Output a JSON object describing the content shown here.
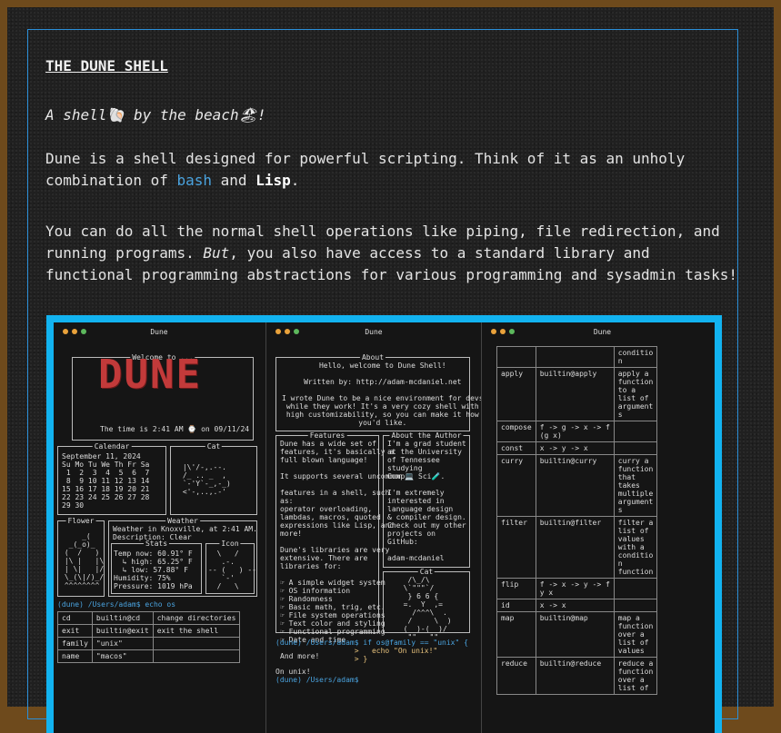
{
  "article": {
    "title": "THE DUNE SHELL",
    "tagline": "A shell🐚 by the beach🏖!",
    "p1_a": "Dune is a shell designed for powerful scripting. Think of it as an unholy",
    "p1_b": "combination of ",
    "p1_code": "bash",
    "p1_c": " and ",
    "p1_bold": "Lisp",
    "p1_d": ".",
    "p2_a": "You can do all the normal shell operations like piping, file redirection, and",
    "p2_b": "running programs. ",
    "p2_em": "But",
    "p2_c": ", you also have access to a standard library and",
    "p2_d": "functional programming abstractions for various programming and sysadmin tasks!"
  },
  "colors": {
    "accent": "#12b3f0",
    "link": "#4aa3df",
    "page_bg": "#202020",
    "frame": "#6e4a1c"
  },
  "screenshot": {
    "pane1": {
      "window_title": "Dune",
      "welcome": "Welcome to ...",
      "logo": "DUNE",
      "time_line": "The time is 2:41 AM ⌚ on 09/11/24",
      "calendar_label": "Calendar",
      "calendar_text": "September 11, 2024\nSu Mo Tu We Th Fr Sa\n 1  2  3  4  5  6  7\n 8  9 10 11 12 13 14\n15 16 17 18 19 20 21\n22 23 24 25 26 27 28\n29 30",
      "cat_label": "Cat",
      "cat_art": " |\\'/-,.--.\n /_ .. _  ,\n `-'Y`-_,-_)\n <'-,..,.-'",
      "flower_label": "Flower",
      "flower_art": "     _(\n  _(_o)_\n (  /   )\n |\\ |   |\\\n | \\|   |/\n \\_(\\|/)_/\n ^^^^^^^^",
      "weather_label": "Weather",
      "weather_text": "Weather in Knoxville, at 2:41 AM.\nDescription: Clear",
      "stats_label": "Stats",
      "stats_text": "Temp now: 60.91° F\n  ↳ high: 65.25° F\n  ↳ low: 57.88° F\nHumidity: 75%\nPressure: 1019 hPa",
      "icon_label": "Icon",
      "icon_art": "  \\   /\n   .-.\n-- (   ) --\n   `-'\n  /   \\",
      "prompt": "(dune) /Users/adam$ echo os",
      "table": [
        [
          "cd",
          "builtin@cd",
          "change directories"
        ],
        [
          "exit",
          "builtin@exit",
          "exit the shell"
        ],
        [
          "family",
          "\"unix\"",
          ""
        ],
        [
          "name",
          "\"macos\"",
          ""
        ]
      ]
    },
    "pane2": {
      "window_title": "Dune",
      "about_label": "About",
      "about_text": "Hello, welcome to Dune Shell!\n\nWritten by: http://adam-mcdaniel.net\n\nI wrote Dune to be a nice environment for devs\nwhile they work! It's a very cozy shell with\nhigh customizability, so you can make it how\nyou'd like.",
      "features_label": "Features",
      "features_text": "Dune has a wide set of\nfeatures, it's basically a\nfull blown language!\n\nIt supports several uncommon\n\nfeatures in a shell, such\nas:\noperator overloading,\nlambdas, macros, quoted\nexpressions like Lisp, and\nmore!\n\nDune's libraries are very\nextensive. There are\nlibraries for:\n\n☞ A simple widget system\n☞ OS information\n☞ Randomness\n☞ Basic math, trig, etc.\n☞ File system operations\n☞ Text color and styling\n☞ Functional programming\n☞ Date and time\n\nAnd more!",
      "author_label": "About the Author",
      "author_text": "I'm a grad student\nat the University\nof Tennessee\nstudying\nComp💻 Sci🧪.\n\nI'm extremely\ninterested in\nlanguage design\n& compiler design.\nCheck out my other\nprojects on\nGitHub:\n\nadam-mcdaniel",
      "cat_label": "Cat",
      "cat_art": "   /\\_/\\\n  \\`\"\"\"`/\n   } 6 6 {\n  =.  Y  ,=\n    /^^^\\  .\n   /     \\  )\n  (  )-(  )/\n   \"\"   \"\"",
      "prompt1": "(dune) /Users/adam$ if os@family == \"unix\" {",
      "prompt2": "                  >   echo \"On unix!\"",
      "prompt3": "                  > }",
      "output": "On unix!",
      "prompt4": "(dune) /Users/adam$ "
    },
    "pane3": {
      "window_title": "Dune",
      "table": [
        [
          "",
          "",
          "conditio\nn"
        ],
        [
          "apply",
          "builtin@apply",
          "apply a\nfunction\nto a\nlist of\nargument\ns"
        ],
        [
          "compose",
          "f -> g -> x -> f\n(g x)",
          ""
        ],
        [
          "const",
          "x -> y -> x",
          ""
        ],
        [
          "curry",
          "builtin@curry",
          "curry a\nfunction\nthat\ntakes\nmultiple\nargument\ns"
        ],
        [
          "filter",
          "builtin@filter",
          "filter a\nlist of\nvalues\nwith a\nconditio\nn\nfunction"
        ],
        [
          "flip",
          "f -> x -> y -> f\ny x",
          ""
        ],
        [
          "id",
          "x -> x",
          ""
        ],
        [
          "map",
          "builtin@map",
          "map a\nfunction\nover a\nlist of\nvalues"
        ],
        [
          "reduce",
          "builtin@reduce",
          "reduce a\nfunction\nover a\nlist of"
        ]
      ]
    }
  }
}
